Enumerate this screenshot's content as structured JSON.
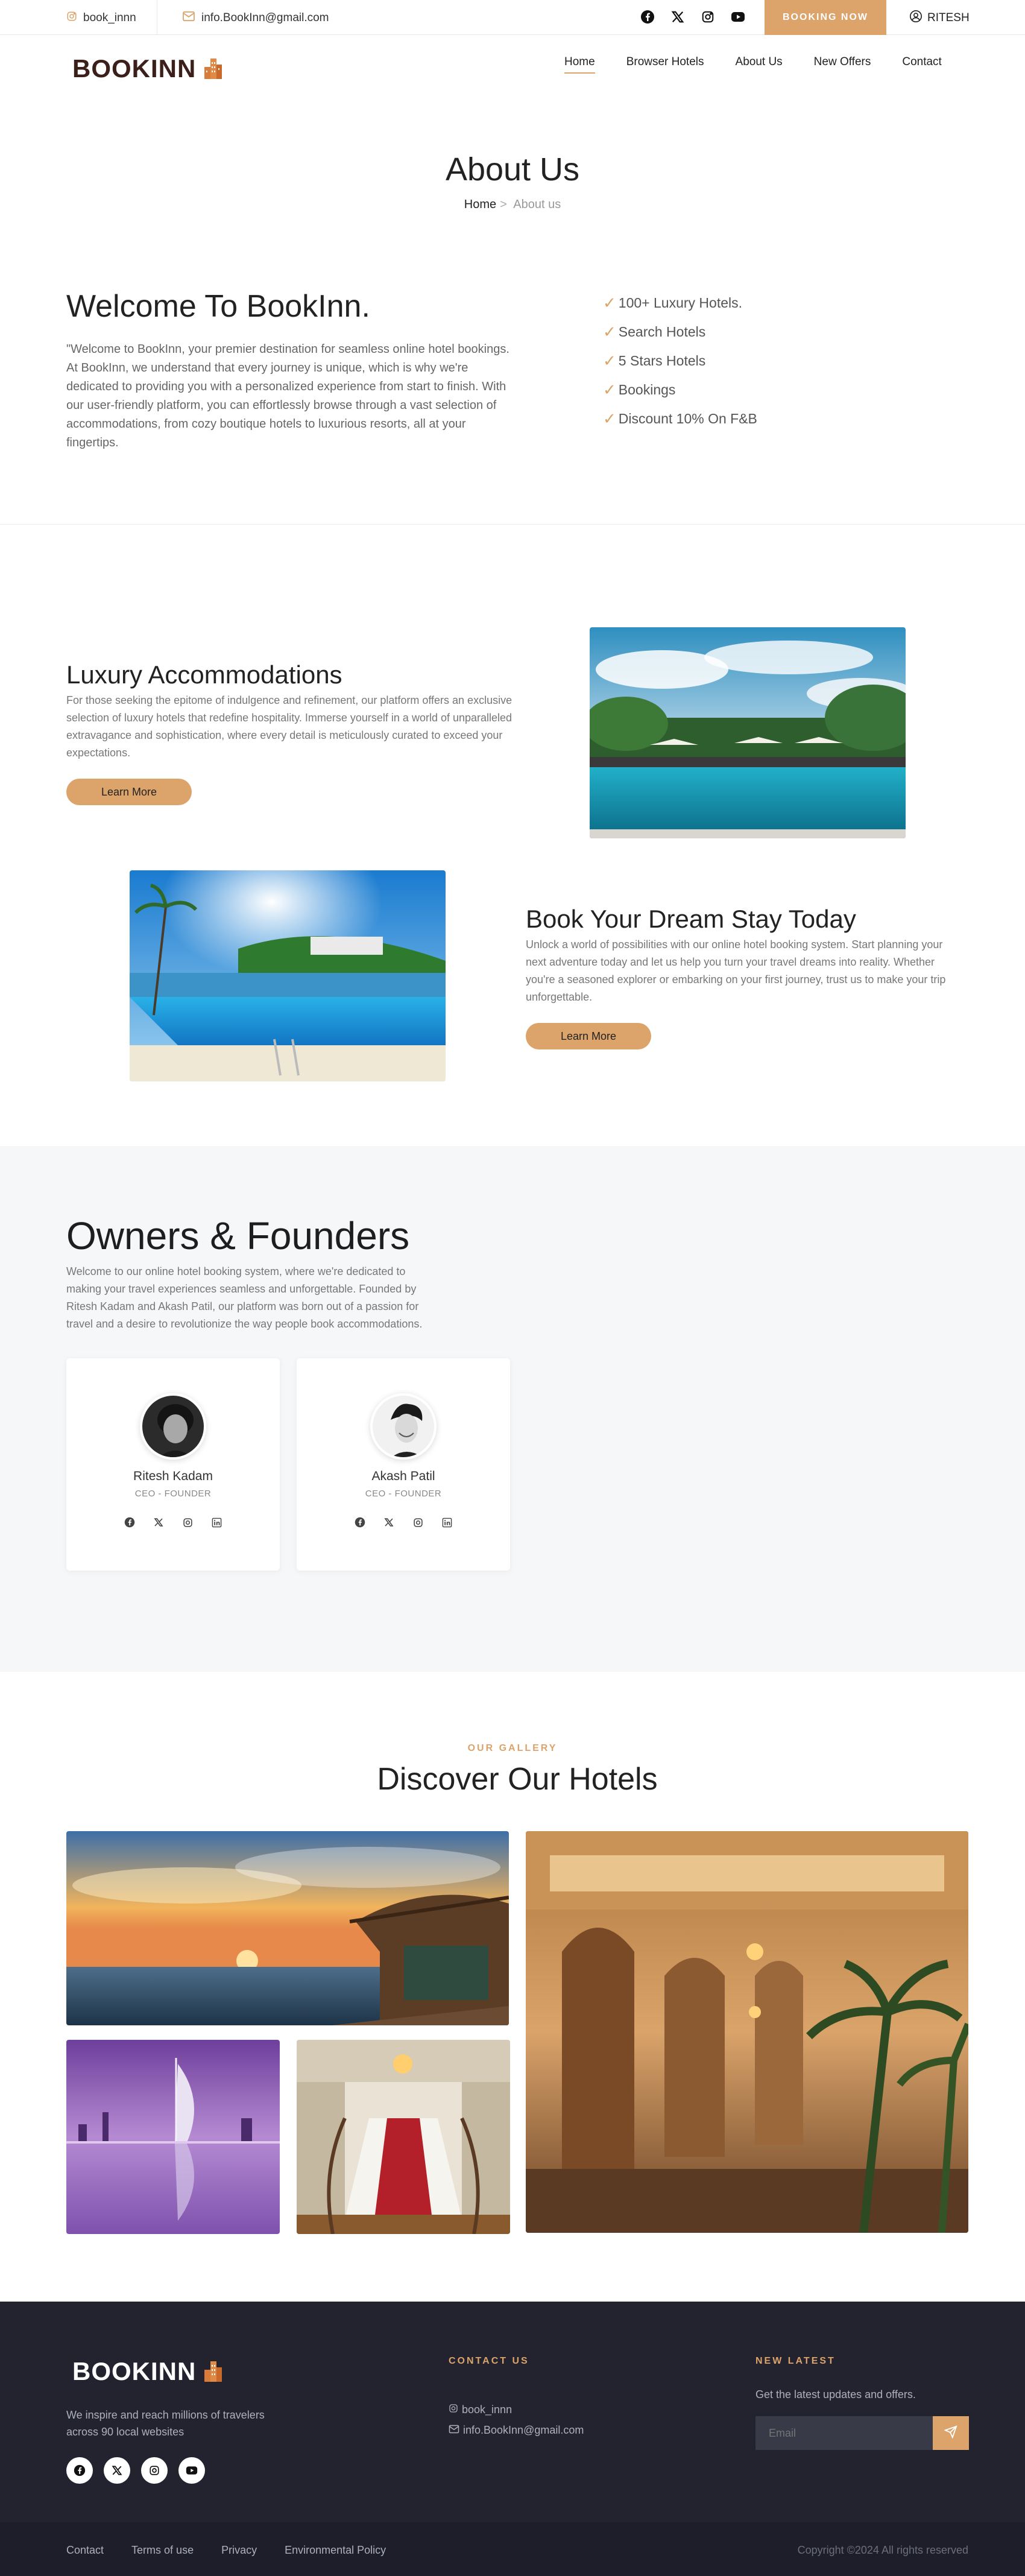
{
  "topbar": {
    "instagram_handle": "book_innn",
    "email": "info.BookInn@gmail.com",
    "booking_label": "BOOKING NOW",
    "user_label": "RITESH"
  },
  "brand": {
    "name": "BOOKINN",
    "accent": "#dca36b"
  },
  "nav": {
    "items": [
      "Home",
      "Browser Hotels",
      "About Us",
      "New Offers",
      "Contact"
    ],
    "active": "Home"
  },
  "hero": {
    "title": "About Us",
    "breadcrumb_home": "Home",
    "breadcrumb_sep": ">",
    "breadcrumb_current": "About us"
  },
  "welcome": {
    "title": "Welcome To BookInn.",
    "body": "\"Welcome to BookInn, your premier destination for seamless online hotel bookings. At BookInn, we understand that every journey is unique, which is why we're dedicated to providing you with a personalized experience from start to finish. With our user-friendly platform, you can effortlessly browse through a vast selection of accommodations, from cozy boutique hotels to luxurious resorts, all at your fingertips.",
    "features": [
      "100+ Luxury Hotels.",
      "Search Hotels",
      "5 Stars Hotels",
      "Bookings",
      "Discount 10% On F&B"
    ]
  },
  "luxury": {
    "title": "Luxury Accommodations",
    "body": "For those seeking the epitome of indulgence and refinement, our platform offers an exclusive selection of luxury hotels that redefine hospitality. Immerse yourself in a world of unparalleled extravagance and sophistication, where every detail is meticulously curated to exceed your expectations.",
    "button": "Learn More"
  },
  "dream": {
    "title": "Book Your Dream Stay Today",
    "body": "Unlock a world of possibilities with our online hotel booking system. Start planning your next adventure today and let us help you turn your travel dreams into reality. Whether you're a seasoned explorer or embarking on your first journey, trust us to make your trip unforgettable.",
    "button": "Learn More"
  },
  "owners": {
    "title": "Owners & Founders",
    "body": "Welcome to our online hotel booking system, where we're dedicated to making your travel experiences seamless and unforgettable. Founded by Ritesh Kadam and Akash Patil, our platform was born out of a passion for travel and a desire to revolutionize the way people book accommodations.",
    "people": [
      {
        "name": "Ritesh Kadam",
        "role": "CEO - FOUNDER"
      },
      {
        "name": "Akash Patil",
        "role": "CEO - FOUNDER"
      }
    ]
  },
  "gallery": {
    "eyebrow": "OUR GALLERY",
    "title": "Discover Our Hotels"
  },
  "footer": {
    "brand": "BOOKINN",
    "description": "We inspire and reach millions of travelers across 90 local websites",
    "contact_heading": "CONTACT US",
    "contact_instagram": "book_innn",
    "contact_email": "info.BookInn@gmail.com",
    "news_heading": "NEW LATEST",
    "news_text": "Get the latest updates and offers.",
    "email_placeholder": "Email",
    "links": [
      "Contact",
      "Terms of use",
      "Privacy",
      "Environmental Policy"
    ],
    "copyright": "Copyright ©2024 All rights reserved"
  }
}
